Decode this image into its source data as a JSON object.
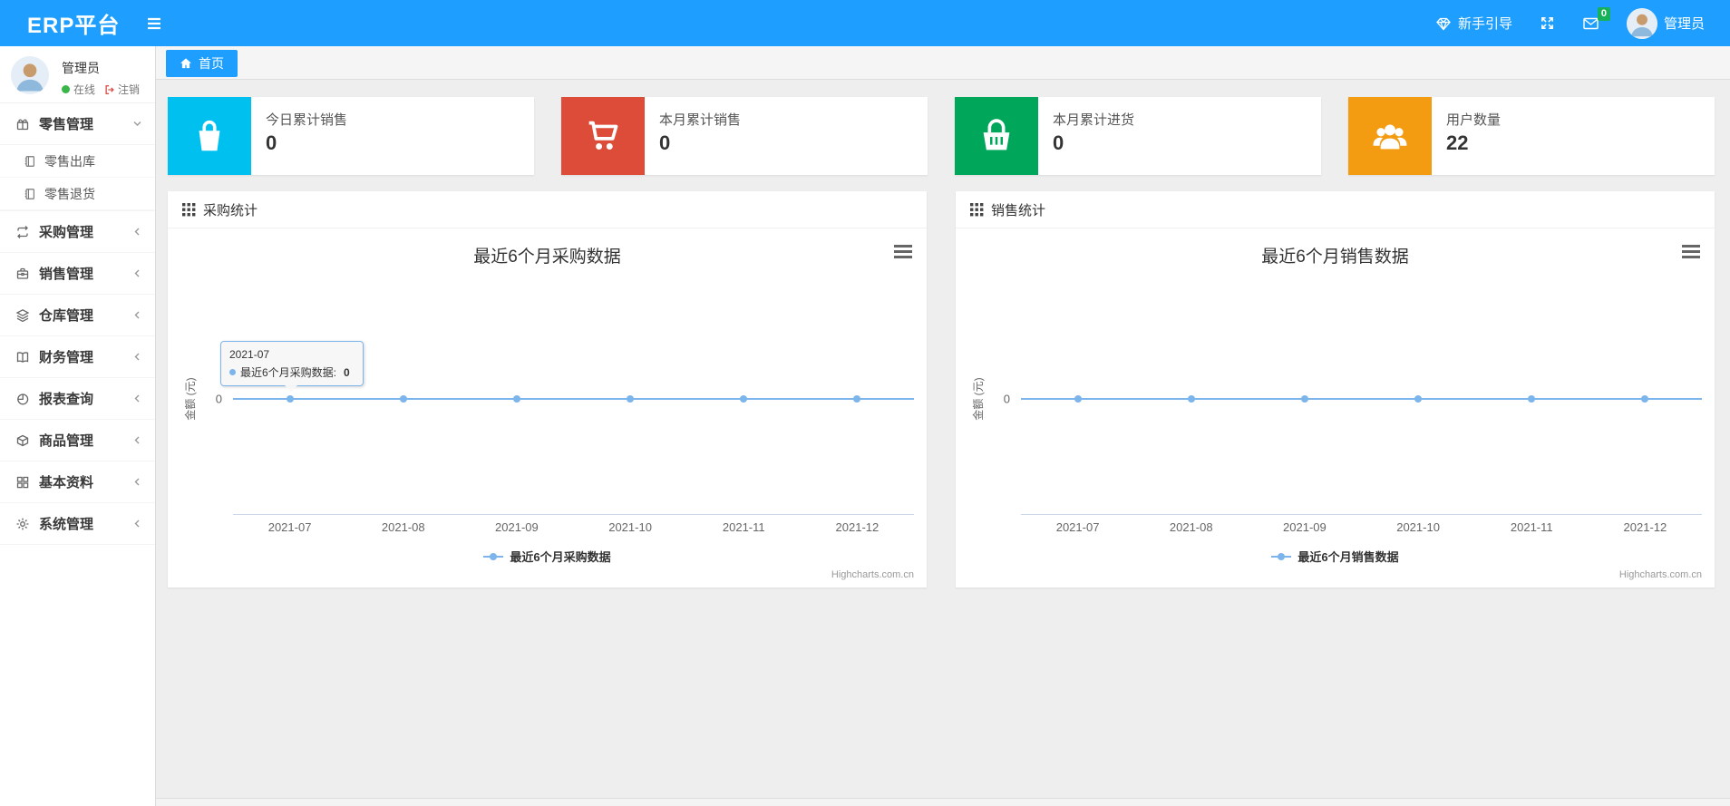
{
  "navbar": {
    "brand": "ERP平台",
    "guide_label": "新手引导",
    "mail_badge": "0",
    "username": "管理员"
  },
  "sidebar": {
    "user": {
      "name": "管理员",
      "status": "在线",
      "logout": "注销"
    },
    "menu": [
      {
        "label": "零售管理",
        "icon": "gift-icon",
        "state": "expanded",
        "children": [
          {
            "label": "零售出库",
            "icon": "notebook-icon"
          },
          {
            "label": "零售退货",
            "icon": "notebook-icon"
          }
        ]
      },
      {
        "label": "采购管理",
        "icon": "exchange-icon"
      },
      {
        "label": "销售管理",
        "icon": "briefcase-icon"
      },
      {
        "label": "仓库管理",
        "icon": "layers-icon"
      },
      {
        "label": "财务管理",
        "icon": "map-book-icon"
      },
      {
        "label": "报表查询",
        "icon": "pie-chart-icon"
      },
      {
        "label": "商品管理",
        "icon": "package-icon"
      },
      {
        "label": "基本资料",
        "icon": "grid-icon"
      },
      {
        "label": "系统管理",
        "icon": "gear-icon"
      }
    ]
  },
  "tabs": [
    {
      "label": "首页",
      "active": true
    }
  ],
  "cards": [
    {
      "label": "今日累计销售",
      "value": "0",
      "icon": "shopping-bag-icon",
      "color": "#00c0ef"
    },
    {
      "label": "本月累计销售",
      "value": "0",
      "icon": "shopping-cart-icon",
      "color": "#dd4b39"
    },
    {
      "label": "本月累计进货",
      "value": "0",
      "icon": "shopping-basket-icon",
      "color": "#00a65a"
    },
    {
      "label": "用户数量",
      "value": "22",
      "icon": "users-icon",
      "color": "#f39c12"
    }
  ],
  "panels": [
    {
      "header": "采购统计"
    },
    {
      "header": "销售统计"
    }
  ],
  "chart_data": [
    {
      "type": "line",
      "title": "最近6个月采购数据",
      "categories": [
        "2021-07",
        "2021-08",
        "2021-09",
        "2021-10",
        "2021-11",
        "2021-12"
      ],
      "series": [
        {
          "name": "最近6个月采购数据",
          "values": [
            0,
            0,
            0,
            0,
            0,
            0
          ],
          "color": "#7cb5ec"
        }
      ],
      "ylabel": "金额 (元)",
      "yticks": [
        0
      ],
      "grid": false,
      "legend_position": "bottom",
      "credits": "Highcharts.com.cn",
      "tooltip": {
        "visible": true,
        "category": "2021-07",
        "series_label": "最近6个月采购数据:",
        "value": 0
      }
    },
    {
      "type": "line",
      "title": "最近6个月销售数据",
      "categories": [
        "2021-07",
        "2021-08",
        "2021-09",
        "2021-10",
        "2021-11",
        "2021-12"
      ],
      "series": [
        {
          "name": "最近6个月销售数据",
          "values": [
            0,
            0,
            0,
            0,
            0,
            0
          ],
          "color": "#7cb5ec"
        }
      ],
      "ylabel": "金额 (元)",
      "yticks": [
        0
      ],
      "grid": false,
      "legend_position": "bottom",
      "credits": "Highcharts.com.cn",
      "tooltip": {
        "visible": false
      }
    }
  ],
  "colors": {
    "navbar": "#1E9FFF",
    "tab_active": "#1E9FFF",
    "badge_green": "#17b15a",
    "card_cyan": "#00c0ef",
    "card_red": "#dd4b39",
    "card_green": "#00a65a",
    "card_orange": "#f39c12",
    "chart_line": "#7cb5ec",
    "status_online": "#39b54a"
  }
}
